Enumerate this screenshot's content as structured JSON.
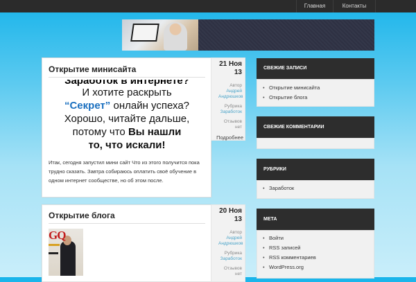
{
  "nav": {
    "items": [
      {
        "label": "Главная"
      },
      {
        "label": "Контакты"
      }
    ]
  },
  "posts": [
    {
      "title": "Открытие минисайта",
      "day": "21 Ноя",
      "year": "13",
      "author_label": "Автор",
      "author": "Андрей Андрюшков",
      "category_label": "Рубрика",
      "category": "Заработок",
      "comments": "Отзывов нет",
      "more": "Подробнее",
      "promo": {
        "line0": "Заработок в интернете?",
        "line1": "И хотите раскрыть",
        "line2_highlight": "“Секрет”",
        "line2_rest": " онлайн успеха?",
        "line3": "Хорошо, читайте дальше,",
        "line4_start": "потому что ",
        "line4_bold": "Вы нашли",
        "line5": "то, что искали!"
      },
      "text": "Итак, сегодня запустил мини сайт Что из этого получится пока трудно сказать. Завтра собираюсь оплатить своё обучение в одном интернет сообществе, но об этом после."
    },
    {
      "title": "Открытие блога",
      "day": "20 Ноя",
      "year": "13",
      "author_label": "Автор",
      "author": "Андрей Андрюшков",
      "category_label": "Рубрика",
      "category": "Заработок",
      "comments": "Отзывов нет",
      "magazine_logo": "GQ"
    }
  ],
  "sidebar": {
    "recent_posts": {
      "title": "СВЕЖИЕ ЗАПИСИ",
      "items": [
        "Открытие минисайта",
        "Открытие блога"
      ]
    },
    "recent_comments": {
      "title": "СВЕЖИЕ КОММЕНТАРИИ"
    },
    "categories": {
      "title": "РУБРИКИ",
      "items": [
        "Заработок"
      ]
    },
    "meta": {
      "title": "МЕТА",
      "items": [
        "Войти",
        "RSS записей",
        "RSS комментариев",
        "WordPress.org"
      ]
    }
  }
}
